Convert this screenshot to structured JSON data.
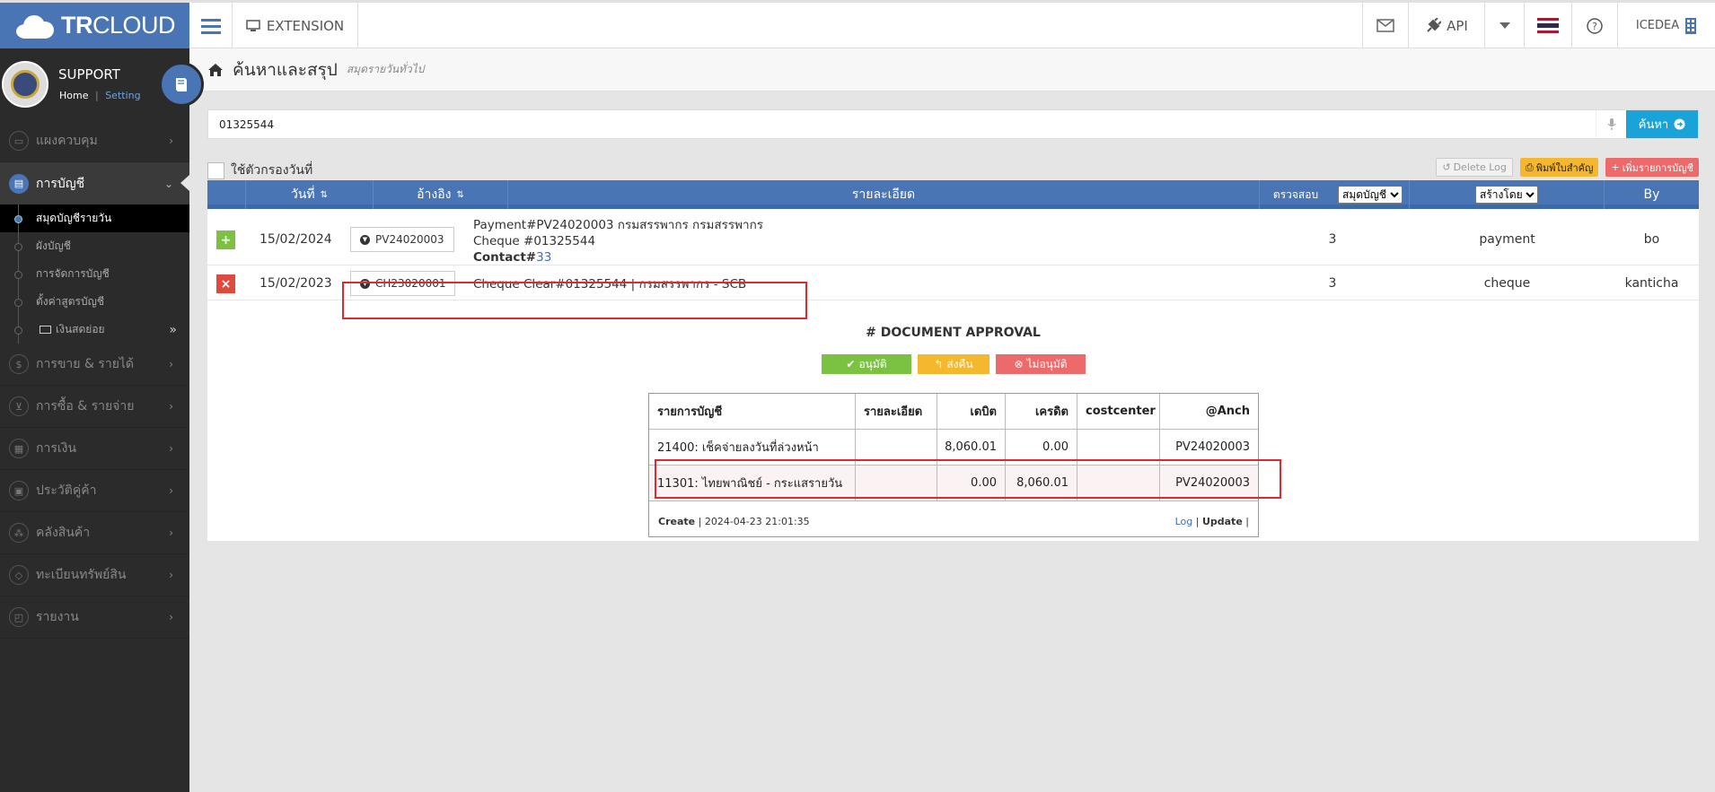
{
  "brand": {
    "bold": "TR",
    "light": "CLOUD"
  },
  "topbar": {
    "extension_label": "EXTENSION",
    "api_label": "API",
    "company_label": "ICEDEA"
  },
  "profile": {
    "name": "SUPPORT",
    "home_link": "Home",
    "separator": "|",
    "setting_link": "Setting"
  },
  "sidebar": {
    "items": [
      {
        "label": "แผงควบคุม",
        "icon": "monitor-icon"
      },
      {
        "label": "การบัญชี",
        "icon": "book-icon"
      },
      {
        "label": "การขาย & รายได้",
        "icon": "dollar-icon"
      },
      {
        "label": "การซื้อ & รายจ่าย",
        "icon": "cart-icon"
      },
      {
        "label": "การเงิน",
        "icon": "calendar-icon"
      },
      {
        "label": "ประวัติคู่ค้า",
        "icon": "contact-icon"
      },
      {
        "label": "คลังสินค้า",
        "icon": "boxes-icon"
      },
      {
        "label": "ทะเบียนทรัพย์สิน",
        "icon": "diamond-icon"
      },
      {
        "label": "รายงาน",
        "icon": "report-icon"
      }
    ],
    "subitems": [
      {
        "label": "สมุดบัญชีรายวัน"
      },
      {
        "label": "ผังบัญชี"
      },
      {
        "label": "การจัดการบัญชี"
      },
      {
        "label": "ตั้งค่าสูตรบัญชี"
      },
      {
        "label": "เงินสดย่อย"
      }
    ]
  },
  "page": {
    "title": "ค้นหาและสรุป",
    "subtitle": "สมุดรายวันทั่วไป"
  },
  "search": {
    "value": "01325544",
    "button_label": "ค้นหา"
  },
  "filter": {
    "label": "ใช้ตัวกรองวันที่"
  },
  "toolbar": {
    "delete_log": "Delete Log",
    "print": "พิมพ์ใบสำคัญ",
    "add": "เพิ่มรายการบัญชี"
  },
  "table": {
    "headers": {
      "date": "วันที่",
      "ref": "อ้างอิง",
      "detail": "รายละเอียด",
      "check": "ตรวจสอบ",
      "book_select": "สมุดบัญชี",
      "created_select": "สร้างโดย",
      "by": "By"
    },
    "rows": [
      {
        "date": "15/02/2024",
        "ref": "PV24020003",
        "line1": "Payment#PV24020003 กรมสรรพากร กรมสรรพากร",
        "line2": "Cheque #01325544",
        "contact_label": "Contact#",
        "contact_num": "33",
        "check": "3",
        "book": "payment",
        "by": "bo"
      },
      {
        "date": "15/02/2023",
        "ref": "CH23020001",
        "line1": "Cheque Clear#01325544 | กรมสรรพากร - SCB",
        "check": "3",
        "book": "cheque",
        "by": "kanticha"
      }
    ]
  },
  "approval": {
    "title": "# DOCUMENT APPROVAL",
    "approve": "อนุมัติ",
    "return": "ส่งคืน",
    "reject": "ไม่อนุมัติ"
  },
  "journal": {
    "headers": [
      "รายการบัญชี",
      "รายละเอียด",
      "เดบิต",
      "เครดิต",
      "costcenter",
      "@Anch"
    ],
    "rows": [
      [
        "21400: เช็คจ่ายลงวันที่ล่วงหน้า",
        "",
        "8,060.01",
        "0.00",
        "",
        "PV24020003"
      ],
      [
        "11301: ไทยพาณิชย์ - กระแสรายวัน",
        "",
        "0.00",
        "8,060.01",
        "",
        "PV24020003"
      ]
    ],
    "create_label": "Create",
    "create_sep": "|",
    "create_time": "2024-04-23 21:01:35",
    "log_link": "Log",
    "update_link": "Update",
    "sep": "|"
  },
  "colors": {
    "brand": "#4a75b5",
    "search_button": "#1aa3d9",
    "approve": "#7cc242",
    "return": "#f5b72e",
    "reject": "#ec6a6a",
    "highlight_box": "#e0282e"
  }
}
